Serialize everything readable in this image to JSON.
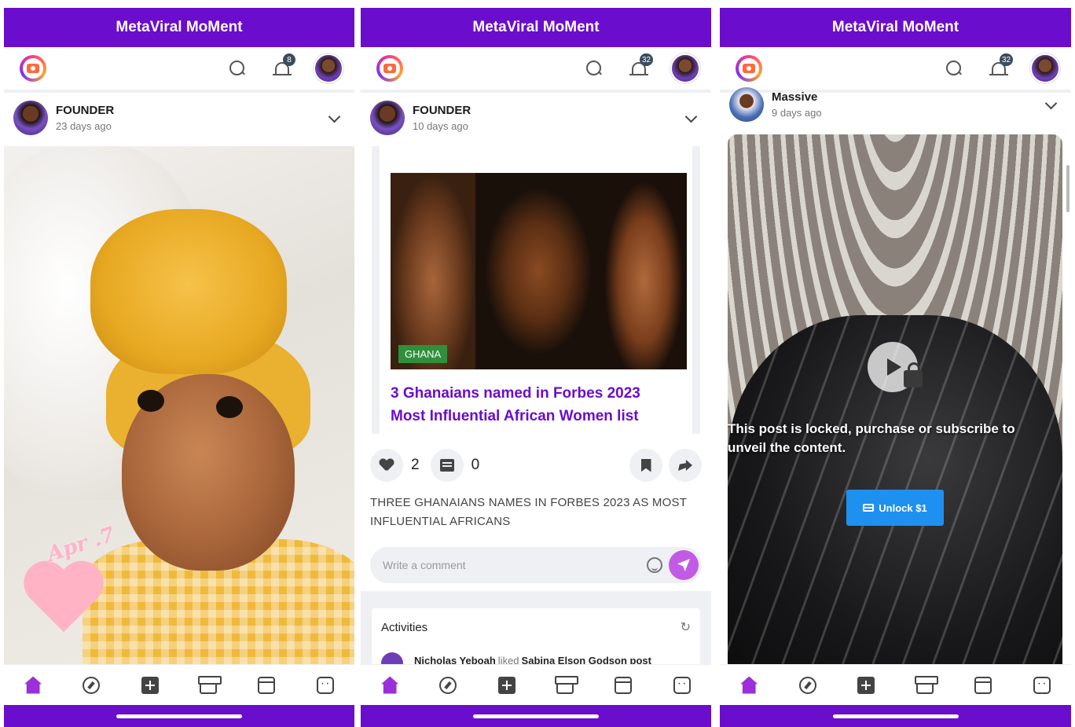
{
  "app_title": "MetaViral MoMent",
  "screens": [
    {
      "notification_count": "8",
      "post": {
        "author": "FOUNDER",
        "time": "23 days ago",
        "sticker_text": "Apr .7"
      }
    },
    {
      "notification_count": "32",
      "post": {
        "author": "FOUNDER",
        "time": "10 days ago",
        "image_tag": "GHANA",
        "headline": "3 Ghanaians named in Forbes 2023 Most Influential African Women list",
        "likes": "2",
        "comments": "0",
        "caption": "THREE GHANAIANS NAMES IN FORBES 2023 AS MOST INFLUENTIAL AFRICANS"
      },
      "comment_placeholder": "Write a comment",
      "activities": {
        "title": "Activities",
        "items": [
          {
            "actor": "Nicholas Yeboah",
            "verb": "liked",
            "target": "Sabina Elson Godson post"
          }
        ]
      }
    },
    {
      "notification_count": "32",
      "post": {
        "author": "Massive",
        "time": "9 days ago",
        "locked_message": "This post is locked, purchase or subscribe to unveil the content.",
        "unlock_label": "Unlock $1"
      }
    }
  ],
  "colors": {
    "brand": "#6a0dcc",
    "accent": "#c15be6",
    "unlock": "#1e90f0",
    "tag_green": "#2f8f3a"
  },
  "bottom_nav": [
    "home-icon",
    "compass-icon",
    "add-icon",
    "store-icon",
    "reels-icon",
    "messages-icon"
  ]
}
